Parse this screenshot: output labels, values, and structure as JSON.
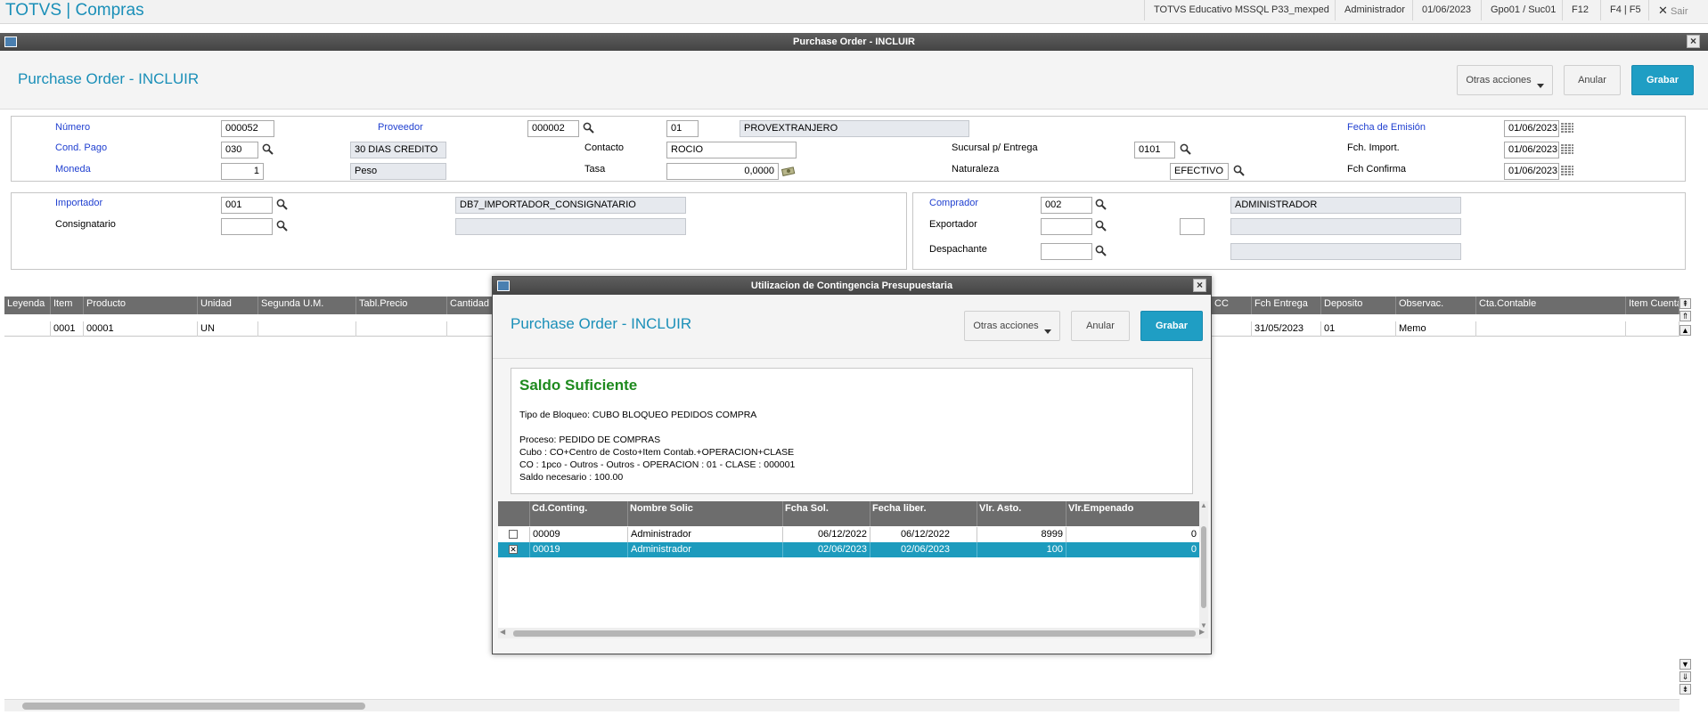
{
  "app": {
    "title": "TOTVS | Compras"
  },
  "topbar": {
    "environment": "TOTVS Educativo MSSQL P33_mexped",
    "user": "Administrador",
    "date": "01/06/2023",
    "branch": "Gpo01 / Suc01",
    "shortcut_f12": "F12",
    "shortcut_f4f5": "F4 | F5",
    "exit_label": "Sair"
  },
  "window": {
    "title": "Purchase Order - INCLUIR"
  },
  "header": {
    "title": "Purchase Order - INCLUIR",
    "more_actions": "Otras acciones",
    "cancel": "Anular",
    "save": "Grabar"
  },
  "form": {
    "numero": {
      "label": "Número",
      "value": "000052"
    },
    "proveedor": {
      "label": "Proveedor",
      "code": "000002",
      "store": "01",
      "name": "PROVEXTRANJERO"
    },
    "fecha_emision": {
      "label": "Fecha de Emisión",
      "value": "01/06/2023"
    },
    "cond_pago": {
      "label": "Cond. Pago",
      "code": "030",
      "desc": "30 DIAS CREDITO"
    },
    "contacto": {
      "label": "Contacto",
      "value": "ROCIO"
    },
    "sucursal_entrega": {
      "label": "Sucursal p/ Entrega",
      "value": "0101"
    },
    "fch_import": {
      "label": "Fch. Import.",
      "value": "01/06/2023"
    },
    "moneda": {
      "label": "Moneda",
      "code": "1",
      "desc": "Peso"
    },
    "tasa": {
      "label": "Tasa",
      "value": "0,0000"
    },
    "naturaleza": {
      "label": "Naturaleza",
      "value": "EFECTIVO"
    },
    "fch_confirma": {
      "label": "Fch Confirma",
      "value": "01/06/2023"
    },
    "importador": {
      "label": "Importador",
      "code": "001",
      "desc": "DB7_IMPORTADOR_CONSIGNATARIO"
    },
    "consignatario": {
      "label": "Consignatario",
      "code": "",
      "desc": ""
    },
    "comprador": {
      "label": "Comprador",
      "code": "002",
      "desc": "ADMINISTRADOR"
    },
    "exportador": {
      "label": "Exportador",
      "code": "",
      "store": "",
      "desc": ""
    },
    "despachante": {
      "label": "Despachante",
      "code": "",
      "desc": ""
    }
  },
  "grid": {
    "columns": [
      "Leyenda",
      "Item",
      "Producto",
      "Unidad",
      "Segunda U.M.",
      "Tabl.Precio",
      "Cantidad",
      "CC",
      "Fch Entrega",
      "Deposito",
      "Observac.",
      "Cta.Contable",
      "Item Cuenta"
    ],
    "rows": [
      {
        "leyenda": "",
        "item": "0001",
        "producto": "00001",
        "unidad": "UN",
        "segunda_um": "",
        "tabl_precio": "",
        "cantidad": "",
        "cc": "",
        "fch_entrega": "31/05/2023",
        "deposito": "01",
        "observac": "Memo",
        "cta_contable": "",
        "item_cuenta": ""
      }
    ]
  },
  "dialog": {
    "title": "Utilizacion de Contingencia Presupuestaria",
    "header_title": "Purchase Order - INCLUIR",
    "more_actions": "Otras acciones",
    "cancel": "Anular",
    "save": "Grabar",
    "status_title": "Saldo Suficiente",
    "status_color": "#1e8a1e",
    "info_lines": [
      "Tipo de Bloqueo: CUBO BLOQUEO PEDIDOS COMPRA",
      "",
      "Proceso: PEDIDO DE COMPRAS",
      "Cubo : CO+Centro de Costo+Item Contab.+OPERACION+CLASE",
      "CO : 1pco - Outros - Outros - OPERACION : 01 - CLASE : 000001",
      "Saldo necesario : 100.00"
    ],
    "table": {
      "columns": [
        "Cd.Conting.",
        "Nombre Solic",
        "Fcha Sol.",
        "Fecha liber.",
        "Vlr. Asto.",
        "Vlr.Empenado"
      ],
      "rows": [
        {
          "checked": false,
          "code": "00009",
          "name": "Administrador",
          "fecha_sol": "06/12/2022",
          "fecha_liber": "06/12/2022",
          "vlr_asto": "8999",
          "vlr_empenado": "0",
          "selected": false
        },
        {
          "checked": true,
          "code": "00019",
          "name": "Administrador",
          "fecha_sol": "02/06/2023",
          "fecha_liber": "02/06/2023",
          "vlr_asto": "100",
          "vlr_empenado": "0",
          "selected": true
        }
      ]
    }
  },
  "colors": {
    "brand": "#1a8fb8",
    "primary_button": "#1f9ec4",
    "selected_row": "#1d9bbd",
    "required_label": "#1f3fd0"
  }
}
